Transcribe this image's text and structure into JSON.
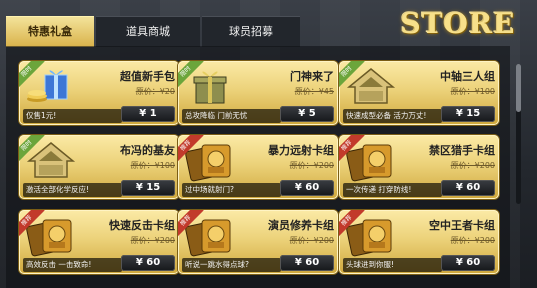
{
  "tabs": [
    {
      "label": "特惠礼盒",
      "active": true
    },
    {
      "label": "道具商城",
      "active": false
    },
    {
      "label": "球员招募",
      "active": false
    }
  ],
  "logo_text": "STORE",
  "cards": [
    {
      "name": "超值新手包",
      "price": "原价：¥20",
      "desc": "仅售1元!",
      "buy": "¥ 1",
      "badge": "限时",
      "badge_color": "green",
      "icon": "gift-box-coins-icon"
    },
    {
      "name": "门神来了",
      "price": "原价：¥45",
      "desc": "总攻降临 门前无忧",
      "buy": "¥ 5",
      "badge": "限时",
      "badge_color": "green",
      "icon": "gift-box-icon"
    },
    {
      "name": "中轴三人组",
      "price": "原价：¥100",
      "desc": "快速成型必备 活力万丈!",
      "buy": "¥ 15",
      "badge": "限时",
      "badge_color": "green",
      "icon": "badge-house-icon"
    },
    {
      "name": "布冯的基友",
      "price": "原价：¥100",
      "desc": "激活全部化学反应!",
      "buy": "¥ 15",
      "badge": "限时",
      "badge_color": "green",
      "icon": "badge-house-icon"
    },
    {
      "name": "暴力远射卡组",
      "price": "原价：¥200",
      "desc": "过中场就射门?",
      "buy": "¥ 60",
      "badge": "推荐",
      "badge_color": "red",
      "icon": "card-pack-icon"
    },
    {
      "name": "禁区猎手卡组",
      "price": "原价：¥200",
      "desc": "一次传递 打穿防线!",
      "buy": "¥ 60",
      "badge": "推荐",
      "badge_color": "red",
      "icon": "card-pack-icon"
    },
    {
      "name": "快速反击卡组",
      "price": "原价：¥200",
      "desc": "高效反击 一击致命!",
      "buy": "¥ 60",
      "badge": "推荐",
      "badge_color": "red",
      "icon": "card-pack-icon"
    },
    {
      "name": "演员修养卡组",
      "price": "原价：¥200",
      "desc": "听说一跳水得点球?",
      "buy": "¥ 60",
      "badge": "推荐",
      "badge_color": "red",
      "icon": "card-pack-pk-icon"
    },
    {
      "name": "空中王者卡组",
      "price": "原价：¥200",
      "desc": "头球进到你服!",
      "buy": "¥ 60",
      "badge": "推荐",
      "badge_color": "red",
      "icon": "card-pack-icon"
    }
  ],
  "colors": {
    "gold": "#e8c768",
    "dark": "#22262c",
    "badge_green": "#6ca53b",
    "badge_red": "#c23a2b"
  }
}
